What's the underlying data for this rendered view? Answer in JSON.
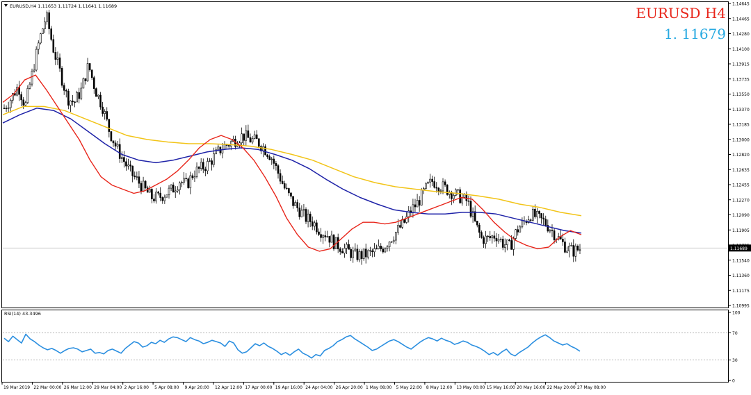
{
  "window": {
    "symbol_line": "EURUSD,H4  1.11653 1.11724 1.11641 1.11689",
    "big_symbol": "EURUSD H4",
    "big_price": "1. 11679"
  },
  "colors": {
    "bull_bear_bars": "#000000",
    "ma_fast": "#e8261b",
    "ma_mid": "#1f23a8",
    "ma_slow": "#f2c418",
    "rsi_line": "#2b8fe0",
    "big_symbol": "#e8261b",
    "big_price": "#27a9e1",
    "price_marker_bg": "#000000",
    "price_marker_text": "#ffffff"
  },
  "chart_data": [
    {
      "type": "candlestick",
      "title": "EURUSD,H4",
      "ylim": [
        1.10995,
        1.14645
      ],
      "y_ticks": [
        "1.14645",
        "1.14465",
        "1.14280",
        "1.14100",
        "1.13915",
        "1.13735",
        "1.13550",
        "1.13370",
        "1.13185",
        "1.13000",
        "1.12820",
        "1.12635",
        "1.12455",
        "1.12270",
        "1.12090",
        "1.11905",
        "1.11725",
        "1.11540",
        "1.11360",
        "1.11175",
        "1.10995"
      ],
      "current_price": "1.11689",
      "x_tick_labels": [
        "19 Mar 2019",
        "22 Mar 00:00",
        "26 Mar 12:00",
        "29 Mar 04:00",
        "2 Apr 16:00",
        "5 Apr 08:00",
        "9 Apr 20:00",
        "12 Apr 12:00",
        "17 Apr 00:00",
        "19 Apr 16:00",
        "24 Apr 04:00",
        "26 Apr 20:00",
        "1 May 08:00",
        "5 May 22:00",
        "8 May 12:00",
        "13 May 00:00",
        "15 May 16:00",
        "20 May 16:00",
        "22 May 20:00",
        "27 May 08:00"
      ],
      "close_series": [
        1.1338,
        1.135,
        1.1365,
        1.134,
        1.138,
        1.142,
        1.145,
        1.141,
        1.138,
        1.135,
        1.1345,
        1.136,
        1.139,
        1.136,
        1.134,
        1.131,
        1.129,
        1.1275,
        1.126,
        1.125,
        1.124,
        1.123,
        1.123,
        1.1235,
        1.124,
        1.125,
        1.1245,
        1.126,
        1.1265,
        1.127,
        1.128,
        1.129,
        1.1295,
        1.13,
        1.1305,
        1.13,
        1.1298,
        1.129,
        1.128,
        1.126,
        1.124,
        1.1225,
        1.1215,
        1.1205,
        1.12,
        1.119,
        1.1185,
        1.1175,
        1.117,
        1.1165,
        1.116,
        1.116,
        1.1162,
        1.1165,
        1.117,
        1.118,
        1.119,
        1.12,
        1.1215,
        1.1225,
        1.124,
        1.125,
        1.1245,
        1.124,
        1.1235,
        1.123,
        1.1225,
        1.12,
        1.118,
        1.118,
        1.1185,
        1.1175,
        1.117,
        1.119,
        1.12,
        1.121,
        1.1205,
        1.12,
        1.119,
        1.118,
        1.117,
        1.1165,
        1.1168
      ],
      "ma_fast": [
        1.1345,
        1.1355,
        1.1372,
        1.1378,
        1.136,
        1.134,
        1.132,
        1.13,
        1.1275,
        1.1255,
        1.1245,
        1.124,
        1.1235,
        1.1238,
        1.1245,
        1.1252,
        1.1262,
        1.1275,
        1.129,
        1.13,
        1.1305,
        1.13,
        1.129,
        1.1275,
        1.1255,
        1.1232,
        1.1205,
        1.1185,
        1.117,
        1.1165,
        1.1168,
        1.118,
        1.1192,
        1.12,
        1.12,
        1.1198,
        1.12,
        1.1205,
        1.121,
        1.1215,
        1.122,
        1.1225,
        1.123,
        1.1228,
        1.1215,
        1.12,
        1.1188,
        1.1178,
        1.1172,
        1.1168,
        1.117,
        1.1182,
        1.119,
        1.1185
      ],
      "ma_mid": [
        1.132,
        1.133,
        1.1338,
        1.1335,
        1.1325,
        1.131,
        1.1295,
        1.1282,
        1.1275,
        1.1272,
        1.1275,
        1.128,
        1.1285,
        1.1288,
        1.129,
        1.1288,
        1.1282,
        1.1275,
        1.1265,
        1.1252,
        1.124,
        1.123,
        1.1222,
        1.1215,
        1.1212,
        1.121,
        1.121,
        1.1212,
        1.1212,
        1.121,
        1.1205,
        1.12,
        1.1195,
        1.119,
        1.1187
      ],
      "ma_slow": [
        1.133,
        1.134,
        1.134,
        1.1335,
        1.1325,
        1.1315,
        1.1305,
        1.13,
        1.1297,
        1.1295,
        1.1295,
        1.1294,
        1.1292,
        1.1288,
        1.1282,
        1.1275,
        1.1265,
        1.1255,
        1.1248,
        1.1243,
        1.124,
        1.1237,
        1.1235,
        1.1232,
        1.1228,
        1.1222,
        1.1218,
        1.1212,
        1.1208
      ]
    },
    {
      "type": "line",
      "title": "RSI(14) 43.3496",
      "ylim": [
        0,
        100
      ],
      "y_ticks": [
        "100",
        "70",
        "30",
        "0"
      ],
      "levels": [
        70,
        30
      ],
      "values": [
        62,
        57,
        65,
        60,
        55,
        68,
        61,
        57,
        52,
        48,
        45,
        47,
        44,
        40,
        44,
        47,
        48,
        46,
        42,
        44,
        46,
        40,
        41,
        39,
        44,
        46,
        43,
        40,
        47,
        52,
        57,
        55,
        49,
        51,
        56,
        54,
        59,
        56,
        61,
        64,
        63,
        60,
        57,
        63,
        60,
        58,
        54,
        56,
        59,
        57,
        55,
        50,
        58,
        55,
        45,
        40,
        42,
        48,
        54,
        51,
        55,
        50,
        47,
        43,
        38,
        41,
        37,
        42,
        46,
        40,
        37,
        33,
        38,
        36,
        44,
        47,
        51,
        57,
        60,
        64,
        66,
        61,
        57,
        53,
        49,
        44,
        46,
        50,
        54,
        58,
        60,
        57,
        53,
        49,
        46,
        51,
        56,
        60,
        63,
        61,
        58,
        62,
        59,
        57,
        53,
        55,
        58,
        56,
        52,
        50,
        47,
        43,
        38,
        41,
        37,
        42,
        46,
        39,
        36,
        41,
        45,
        49,
        55,
        60,
        64,
        67,
        63,
        58,
        55,
        52,
        54,
        50,
        47,
        43
      ]
    }
  ]
}
